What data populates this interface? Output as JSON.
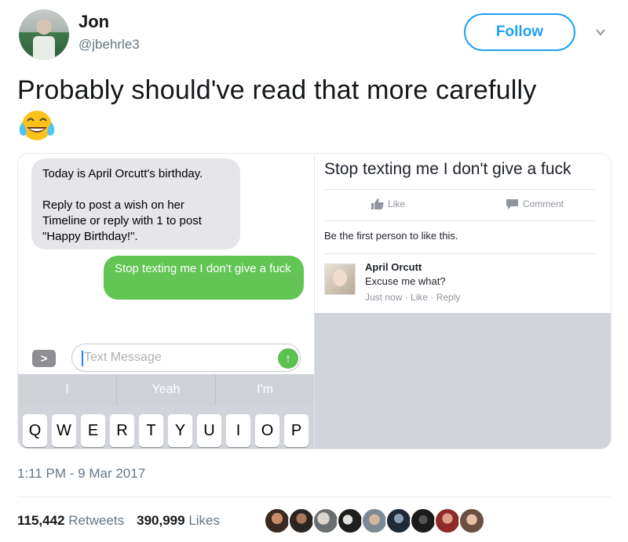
{
  "user": {
    "name": "Jon",
    "handle": "@jbehrle3"
  },
  "follow": {
    "label": "Follow"
  },
  "tweet": {
    "text": "Probably should've read that more carefully"
  },
  "sms": {
    "incoming_line1": "Today is April Orcutt's birthday.",
    "incoming_line2": "Reply to post a wish on her Timeline or reply with 1 to post \"Happy Birthday!\".",
    "outgoing": "Stop texting me I don't give a fuck",
    "expand_label": ">",
    "input_placeholder": "Text Message",
    "send_label": "↑",
    "suggestions": [
      "I",
      "Yeah",
      "I'm"
    ],
    "keys": [
      "Q",
      "W",
      "E",
      "R",
      "T",
      "Y",
      "U",
      "I",
      "O",
      "P"
    ]
  },
  "facebook": {
    "post": "Stop texting me I don't give a fuck",
    "like_label": "Like",
    "comment_label": "Comment",
    "first_like": "Be the first person to like this.",
    "commenter": "April Orcutt",
    "comment": "Excuse me what?",
    "comment_meta": "Just now · Like · Reply"
  },
  "footer": {
    "timestamp": "1:11 PM - 9 Mar 2017",
    "retweets_count": "115,442",
    "retweets_label": "Retweets",
    "likes_count": "390,999",
    "likes_label": "Likes"
  },
  "colors": {
    "accent": "#1da1f2",
    "imessage_green": "#62c554",
    "bubble_grey": "#e5e5ea"
  }
}
